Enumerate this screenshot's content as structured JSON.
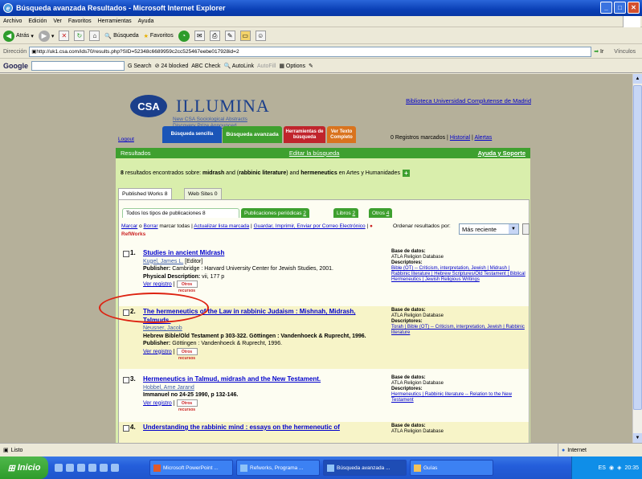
{
  "window": {
    "title": "Búsqueda avanzada Resultados - Microsoft Internet Explorer"
  },
  "menu": [
    "Archivo",
    "Edición",
    "Ver",
    "Favoritos",
    "Herramientas",
    "Ayuda"
  ],
  "toolbar": {
    "back": "Atrás",
    "search": "Búsqueda",
    "favorites": "Favoritos"
  },
  "address": {
    "label": "Dirección",
    "url": "http://uk1.csa.com/ids70/results.php?SID=52348c6689959c2cc525467eebe017928id=2",
    "go": "Ir",
    "links": "Vínculos"
  },
  "google": {
    "label": "Google",
    "search": "Search",
    "blocked": "24 blocked",
    "check": "Check",
    "autolink": "AutoLink",
    "autofill": "AutoFill",
    "options": "Options"
  },
  "site": {
    "logo": "CSA",
    "product": "ILLUMINA",
    "prize": "New CSA Sociological Abstracts Discovery Prize Announced",
    "library": "Biblioteca Universidad Complutense de Madrid",
    "logout": "Logout",
    "tabs": [
      "Búsqueda sencilla",
      "Búsqueda avanzada",
      "Herramientas de búsqueda",
      "Ver Texto Completo"
    ],
    "marked": "0 Registros marcados",
    "history": "Historial",
    "alerts": "Alertas"
  },
  "results_bar": {
    "label": "Resultados",
    "edit": "Editar la búsqueda",
    "help": "Ayuda y Soporte"
  },
  "found": {
    "count": "8",
    "text": "resultados encontrados sobre:",
    "t1": "midrash",
    "and1": "and (",
    "t2": "rabbinic literature",
    "and2": ") and",
    "t3": "hermeneutics",
    "tail": "en Artes y Humanidades"
  },
  "work_tabs": [
    "Published Works 8",
    "Web Sites 0"
  ],
  "pub_tabs": [
    {
      "label": "Todos los tipos de publicaciones 8"
    },
    {
      "label": "Publicaciones periódicas",
      "count": "2"
    },
    {
      "label": "Libros",
      "count": "2"
    },
    {
      "label": "Otros",
      "count": "4"
    }
  ],
  "actions": {
    "marcar": "Marcar",
    "sep1": "o",
    "borrar": "Borrar",
    "todas": "marcar todas",
    "actualizar": "Actualizar lista marcada",
    "guardar": "Guardar, Imprimir, Enviar por Correo Electrónico",
    "refworks": "RefWorks",
    "ordenar": "Ordenar resultados por:",
    "sort_value": "Más reciente"
  },
  "records": [
    {
      "num": "1.",
      "title": "Studies in ancient Midrash",
      "author": "Kugel, James L.",
      "editor": "[Editor]",
      "lines": [
        {
          "label": "Publisher:",
          "text": "Cambridge : Harvard University Center for Jewish Studies, 2001."
        },
        {
          "label": "Physical Description:",
          "text": "vii, 177 p"
        }
      ],
      "view": "Ver registro",
      "db_label": "Base de datos:",
      "db": "ATLA Religion Database",
      "desc_label": "Descriptores:",
      "desc": "Bible (OT) -- Criticism, interpretation, Jewish | Midrash | Rabbinic literature | Hebrew Scriptures/Old Testament | Biblical Hermeneutics | Jewish Religious Writings"
    },
    {
      "num": "2.",
      "title": "The hermeneutics of the Law in rabbinic Judaism : Mishnah, Midrash, Talmuds.",
      "author": "Neusner, Jacob",
      "lines": [
        {
          "label": "",
          "text": "Hebrew Bible/Old Testament p 303-322. Göttingen : Vandenhoeck & Ruprecht, 1996."
        },
        {
          "label": "Publisher:",
          "text": "Göttingen : Vandenhoeck & Ruprecht, 1996."
        }
      ],
      "view": "Ver registro",
      "db_label": "Base de datos:",
      "db": "ATLA Religion Database",
      "desc_label": "Descriptores:",
      "desc": "Torah | Bible (OT) -- Criticism, interpretation, Jewish | Rabbinic literature"
    },
    {
      "num": "3.",
      "title": "Hermeneutics in Talmud, midrash and the New Testament.",
      "author": "Hobbel, Arne Jarand",
      "lines": [
        {
          "label": "",
          "text": "Immanuel no 24-25 1990, p 132-146."
        }
      ],
      "view": "Ver registro",
      "db_label": "Base de datos:",
      "db": "ATLA Religion Database",
      "desc_label": "Descriptores:",
      "desc": "Hermeneutics | Rabbinic literature -- Relation to the New Testament"
    },
    {
      "num": "4.",
      "title": "Understanding the rabbinic mind : essays on the hermeneutic of",
      "db_label": "Base de datos:",
      "db": "ATLA Religion Database"
    }
  ],
  "other_button": "Otros recursos",
  "status": {
    "text": "Listo",
    "zone": "Internet"
  },
  "taskbar": {
    "start": "Inicio",
    "tasks": [
      "Microsoft PowerPoint ...",
      "Refworks, Programa ...",
      "Búsqueda avanzada ...",
      "Guías"
    ],
    "lang": "ES",
    "time": "20:35"
  }
}
